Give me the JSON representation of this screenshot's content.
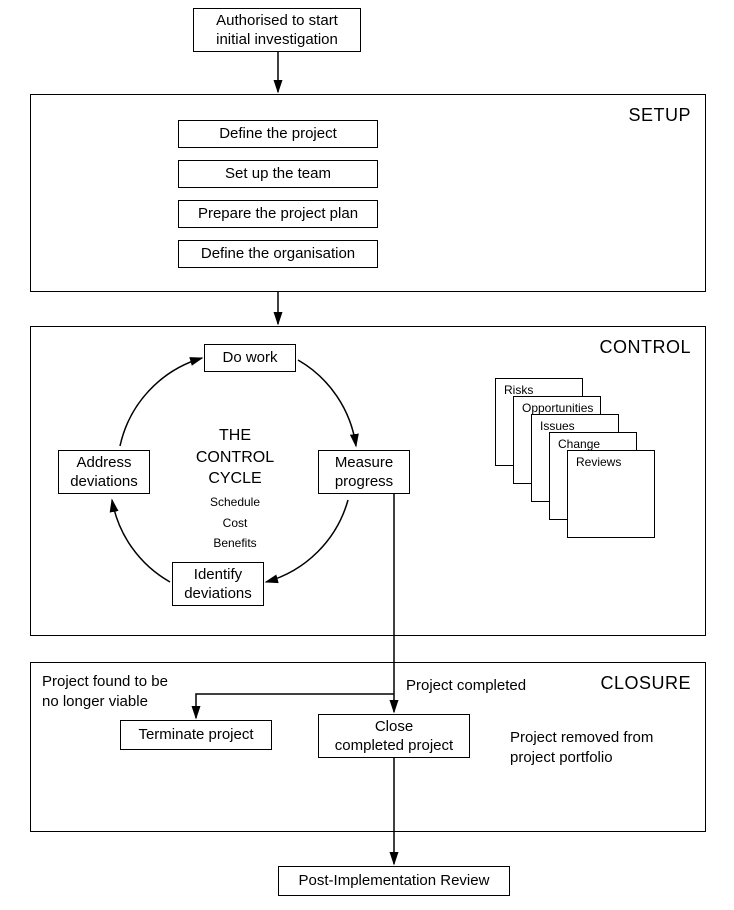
{
  "start_box": "Authorised to start\ninitial investigation",
  "phases": {
    "setup": {
      "label": "SETUP",
      "items": [
        "Define the project",
        "Set up the team",
        "Prepare the project plan",
        "Define the organisation"
      ]
    },
    "control": {
      "label": "CONTROL",
      "center_title": "THE\nCONTROL CYCLE",
      "center_sub": [
        "Schedule",
        "Cost",
        "Benefits"
      ],
      "cycle": {
        "do_work": "Do work",
        "measure": "Measure\nprogress",
        "identify": "Identify\ndeviations",
        "address": "Address\ndeviations"
      },
      "docs": [
        "Risks",
        "Opportunities",
        "Issues",
        "Change",
        "Reviews"
      ]
    },
    "closure": {
      "label": "CLOSURE",
      "not_viable": "Project found to be\nno longer viable",
      "completed": "Project completed",
      "removed": "Project removed from\nproject portfolio",
      "terminate": "Terminate project",
      "close": "Close\ncompleted project"
    }
  },
  "end_box": "Post-Implementation Review"
}
